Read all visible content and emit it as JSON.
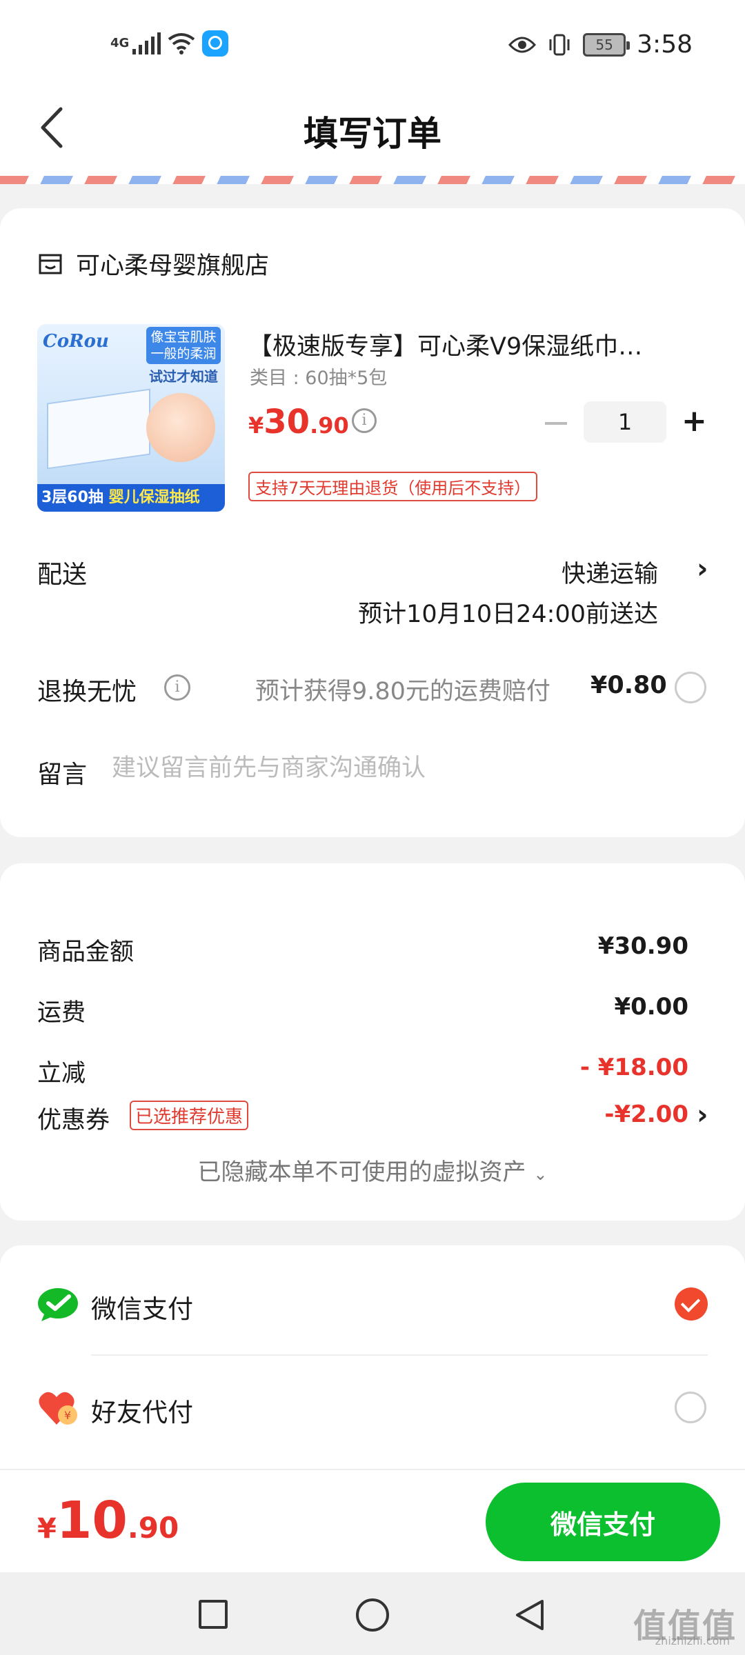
{
  "status_bar": {
    "network": "4G",
    "battery": "55",
    "time": "3:58"
  },
  "header": {
    "title": "填写订单"
  },
  "shop": {
    "name": "可心柔母婴旗舰店"
  },
  "product": {
    "title": "【极速版专享】可心柔V9保湿纸巾…",
    "spec": "类目 : 60抽*5包",
    "price_symbol": "¥",
    "price_int": "30",
    "price_dec": ".90",
    "quantity": "1",
    "return_policy": "支持7天无理由退货（使用后不支持）",
    "image": {
      "brand": "CoRou",
      "tag": "像宝宝肌肤一般的柔润",
      "tag_line2": "",
      "try_text": "试过才知道",
      "bottom_left": "3层60抽",
      "bottom_right": "婴儿保湿抽纸"
    }
  },
  "delivery": {
    "label": "配送",
    "method": "快递运输",
    "eta": "预计10月10日24:00前送达"
  },
  "return_worry_free": {
    "label": "退换无忧",
    "text": "预计获得9.80元的运费赔付",
    "price": "¥0.80"
  },
  "message": {
    "label": "留言",
    "placeholder": "建议留言前先与商家沟通确认"
  },
  "summary": {
    "goods_label": "商品金额",
    "goods_value": "¥30.90",
    "shipping_label": "运费",
    "shipping_value": "¥0.00",
    "discount_label": "立减",
    "discount_value": "- ¥18.00",
    "coupon_label": "优惠券",
    "coupon_tag": "已选推荐优惠",
    "coupon_value": "-¥2.00",
    "hidden_assets": "已隐藏本单不可使用的虚拟资产"
  },
  "payment": {
    "options": [
      {
        "label": "微信支付",
        "selected": true
      },
      {
        "label": "好友代付",
        "selected": false
      }
    ]
  },
  "bottom": {
    "total_symbol": "¥",
    "total_int": "10",
    "total_dec": ".90",
    "pay_button": "微信支付"
  },
  "watermark": {
    "text": "值值值",
    "sub": "zhizhizhi.com"
  },
  "colors": {
    "accent_red": "#e8332c",
    "wechat_green": "#0bbf2f"
  }
}
